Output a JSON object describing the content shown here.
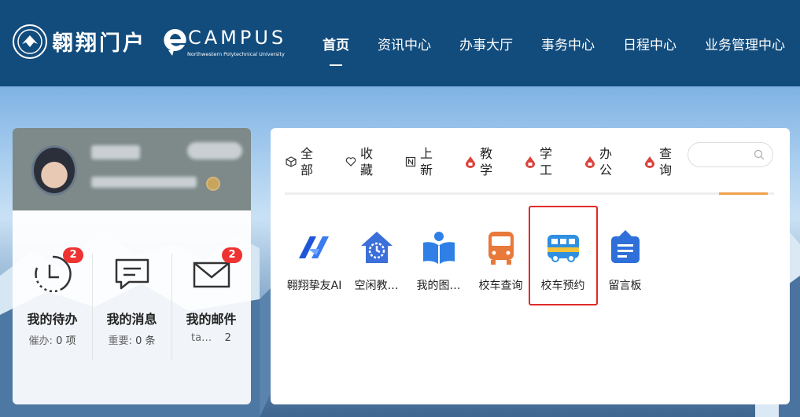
{
  "header": {
    "logo_text": "翱翔门户",
    "brand_word": "CAMPUS",
    "brand_sub": "Northwestern Polytechnical University",
    "nav": [
      {
        "label": "首页",
        "active": true
      },
      {
        "label": "资讯中心"
      },
      {
        "label": "办事大厅"
      },
      {
        "label": "事务中心"
      },
      {
        "label": "日程中心"
      },
      {
        "label": "业务管理中心"
      }
    ]
  },
  "profile": {
    "stats": [
      {
        "title": "我的待办",
        "badge": "2",
        "sub_label": "催办:",
        "sub_value": "0 项",
        "icon": "clock-icon"
      },
      {
        "title": "我的消息",
        "badge": "",
        "sub_label": "重要:",
        "sub_value": "0 条",
        "icon": "message-icon"
      },
      {
        "title": "我的邮件",
        "badge": "2",
        "sub_label": "ta…",
        "sub_value": "2",
        "icon": "mail-icon"
      }
    ]
  },
  "tabs": [
    {
      "label": "全部",
      "icon": "cube-icon"
    },
    {
      "label": "收藏",
      "icon": "heart-icon"
    },
    {
      "label": "上新",
      "icon": "new-icon"
    },
    {
      "label": "教学",
      "icon": "drop-icon"
    },
    {
      "label": "学工",
      "icon": "drop-icon"
    },
    {
      "label": "办公",
      "icon": "drop-icon"
    },
    {
      "label": "查询",
      "icon": "drop-icon"
    }
  ],
  "search": {
    "placeholder": ""
  },
  "apps": [
    {
      "label": "翱翔挚友AI",
      "icon": "ai-logo-icon"
    },
    {
      "label": "空闲教…",
      "icon": "classroom-icon"
    },
    {
      "label": "我的图…",
      "icon": "book-icon"
    },
    {
      "label": "校车查询",
      "icon": "bus-icon"
    },
    {
      "label": "校车预约",
      "icon": "bus-booking-icon"
    },
    {
      "label": "留言板",
      "icon": "message-board-icon"
    }
  ],
  "colors": {
    "header": "#124c7d",
    "accent": "#f0a04b",
    "badge": "#e33333",
    "highlight": "#e02a2a"
  }
}
